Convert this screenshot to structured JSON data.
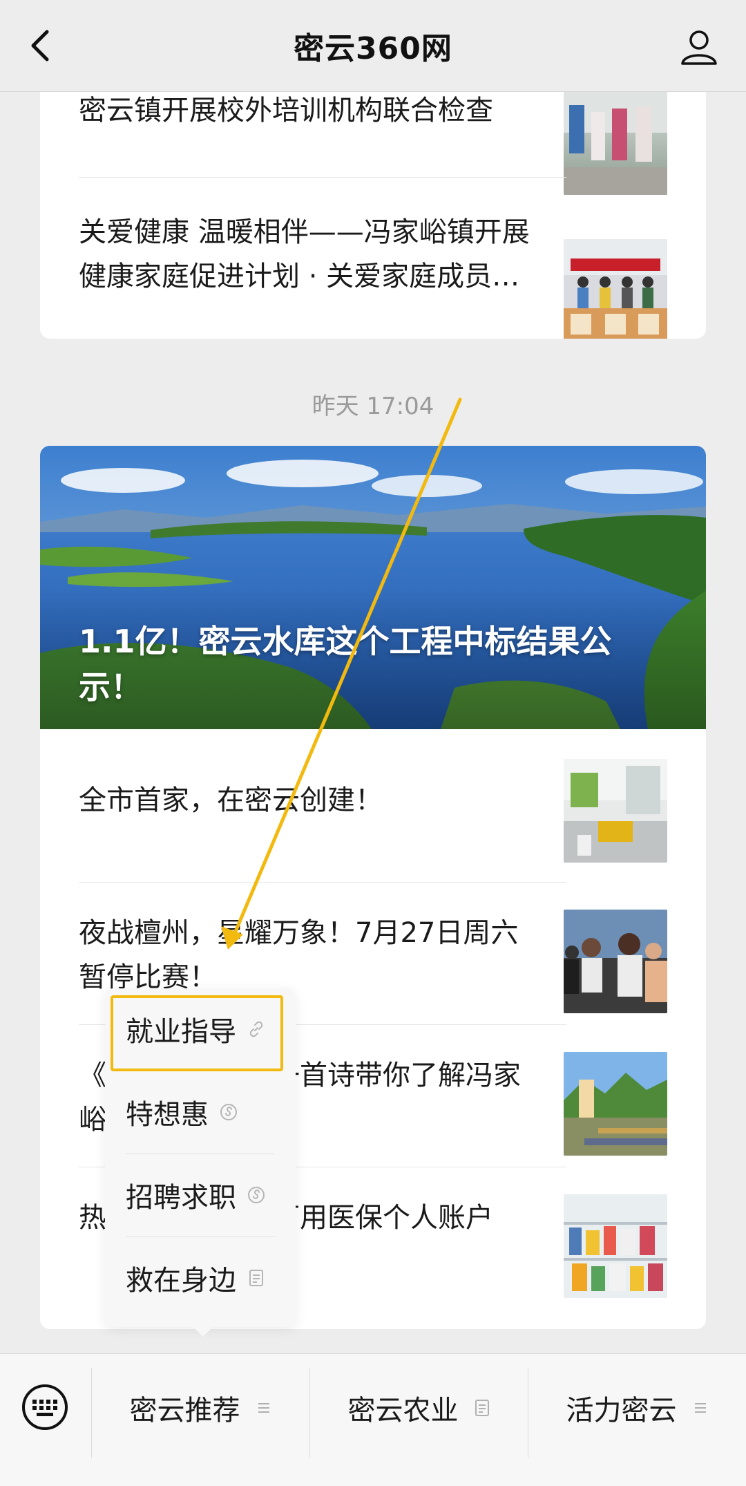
{
  "header": {
    "title": "密云360网",
    "back_icon": "chevron-left-icon",
    "profile_icon": "user-icon"
  },
  "card1": {
    "articles": [
      {
        "title": "密云镇开展校外培训机构联合检查",
        "thumb": "photo-people-inspection"
      },
      {
        "title": "关爱健康 温暖相伴——冯家峪镇开展健康家庭促进计划 · 关爱家庭成员健康活动",
        "thumb": "photo-group-event"
      }
    ]
  },
  "timestamp": "昨天 17:04",
  "card2": {
    "hero_title": "1.1亿！密云水库这个工程中标结果公示！",
    "articles": [
      {
        "title": "全市首家，在密云创建！",
        "thumb": "photo-shop-interior"
      },
      {
        "title": "夜战檀州，星耀万象！7月27日周六暂停比赛！",
        "thumb": "photo-sports-crowd"
      },
      {
        "title": "《冯家峪之美》一首诗带你了解冯家峪镇-冯家峪镇",
        "thumb": "photo-mountain-landscape"
      },
      {
        "title": "热点：药店买药可用医保个人账户",
        "thumb": "photo-pharmacy-shelf"
      }
    ]
  },
  "popup_menu": {
    "items": [
      {
        "label": "就业指导",
        "icon": "link-icon"
      },
      {
        "label": "特想惠",
        "icon": "miniprogram-icon"
      },
      {
        "label": "招聘求职",
        "icon": "miniprogram-icon"
      },
      {
        "label": "救在身边",
        "icon": "article-icon"
      }
    ],
    "highlighted_index": 0
  },
  "bottom_bar": {
    "keyboard_icon": "keyboard-icon",
    "tabs": [
      {
        "label": "密云推荐",
        "icon": "menu-lines-icon"
      },
      {
        "label": "密云农业",
        "icon": "article-icon"
      },
      {
        "label": "活力密云",
        "icon": "menu-lines-icon"
      }
    ]
  },
  "colors": {
    "highlight": "#f2b90f",
    "background": "#ededed"
  }
}
